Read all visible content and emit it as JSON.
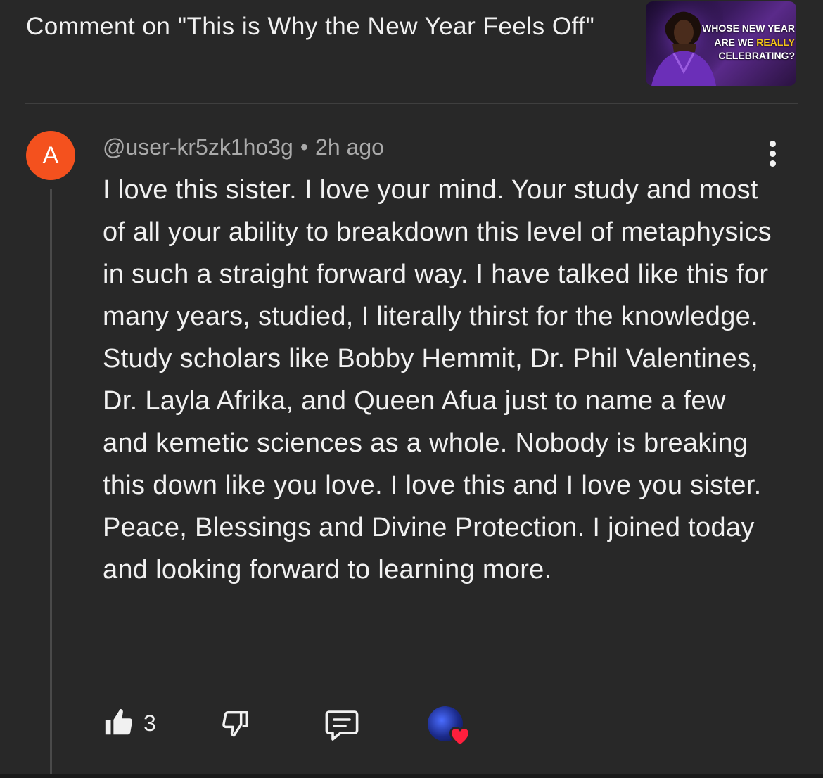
{
  "header": {
    "title": "Comment on \"This is Why the New Year Feels Off\"",
    "thumbnail": {
      "line1": "WHOSE NEW YEAR",
      "line2_prefix": "ARE WE ",
      "line2_highlight": "REALLY",
      "line3": "CELEBRATING?",
      "highlight_color": "#f5c518"
    }
  },
  "comment": {
    "avatar_letter": "A",
    "avatar_color": "#f4511e",
    "author": "@user-kr5zk1ho3g",
    "separator": "•",
    "time": "2h ago",
    "text": "I love this sister. I love your mind. Your study and most of all your ability to breakdown this level of metaphysics in such a straight forward way. I have talked like this for many years, studied, I literally thirst for the knowledge. Study scholars like Bobby Hemmit, Dr. Phil Valentines, Dr. Layla Afrika, and Queen Afua just to name a few and kemetic sciences as a whole. Nobody is breaking this down like you love. I love this and I love you sister. Peace, Blessings and Divine Protection. I joined today and looking forward to learning more."
  },
  "actions": {
    "like_count": "3",
    "icons": [
      "thumbs-up-icon",
      "thumbs-down-icon",
      "reply-icon",
      "creator-heart-icon"
    ],
    "heart_color": "#ff1f3d"
  }
}
